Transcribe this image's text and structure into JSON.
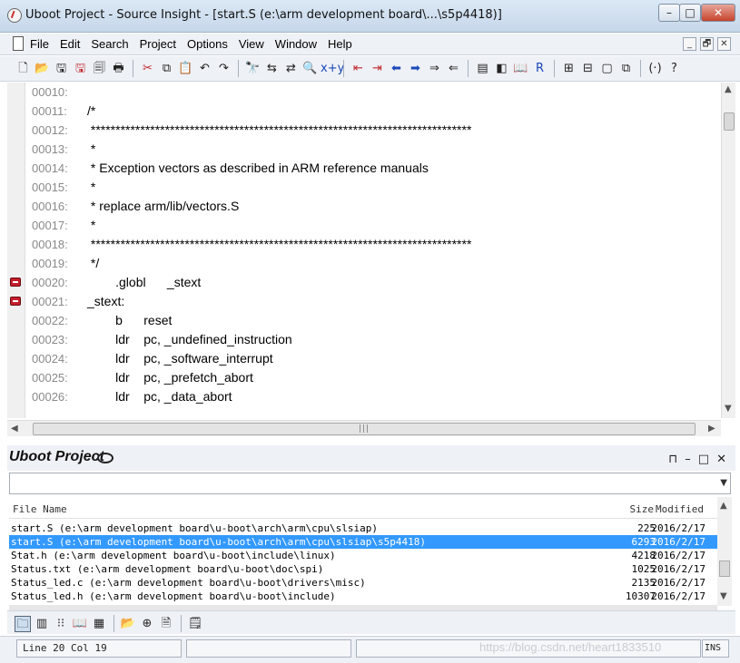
{
  "window": {
    "title": "Uboot Project - Source Insight - [start.S (e:\\arm development board\\...\\s5p4418)]",
    "controls": {
      "minimize": "–",
      "maximize": "□",
      "close": "✕"
    }
  },
  "menu": {
    "items": [
      "File",
      "Edit",
      "Search",
      "Project",
      "Options",
      "View",
      "Window",
      "Help"
    ],
    "mdi_controls": [
      "_",
      "🗗",
      "✕"
    ]
  },
  "toolbar": {
    "groups": [
      [
        {
          "name": "new-icon",
          "glyph": "🗋",
          "tone": "dark"
        },
        {
          "name": "open-icon",
          "glyph": "📂",
          "tone": "dark"
        },
        {
          "name": "save-icon",
          "glyph": "🖫",
          "tone": "dark"
        },
        {
          "name": "save-all-icon",
          "glyph": "🖫",
          "tone": "red"
        },
        {
          "name": "close-file-icon",
          "glyph": "🗐",
          "tone": "dark"
        },
        {
          "name": "print-icon",
          "glyph": "🖶",
          "tone": "dark"
        }
      ],
      [
        {
          "name": "cut-icon",
          "glyph": "✂",
          "tone": "red"
        },
        {
          "name": "copy-icon",
          "glyph": "⧉",
          "tone": "dark"
        },
        {
          "name": "paste-icon",
          "glyph": "📋",
          "tone": "dark"
        },
        {
          "name": "undo-icon",
          "glyph": "↶",
          "tone": "dark"
        },
        {
          "name": "redo-icon",
          "glyph": "↷",
          "tone": "dark"
        }
      ],
      [
        {
          "name": "find-icon",
          "glyph": "🔭",
          "tone": "dark"
        },
        {
          "name": "find-prev-icon",
          "glyph": "⇆",
          "tone": "dark"
        },
        {
          "name": "find-next-icon",
          "glyph": "⇄",
          "tone": "dark"
        },
        {
          "name": "search-files-icon",
          "glyph": "🔍",
          "tone": "dark"
        },
        {
          "name": "replace-icon",
          "glyph": "x+y",
          "tone": "blue"
        }
      ],
      [
        {
          "name": "bookmark-prev-icon",
          "glyph": "⇤",
          "tone": "red"
        },
        {
          "name": "bookmark-next-icon",
          "glyph": "⇥",
          "tone": "red"
        },
        {
          "name": "back-icon",
          "glyph": "⬅",
          "tone": "blue"
        },
        {
          "name": "forward-icon",
          "glyph": "➡",
          "tone": "blue"
        },
        {
          "name": "jump-in-icon",
          "glyph": "⇒",
          "tone": "dark"
        },
        {
          "name": "jump-out-icon",
          "glyph": "⇐",
          "tone": "dark"
        }
      ],
      [
        {
          "name": "symbol-window-icon",
          "glyph": "▤",
          "tone": "dark"
        },
        {
          "name": "lookup-icon",
          "glyph": "◧",
          "tone": "dark"
        },
        {
          "name": "browse-icon",
          "glyph": "📖",
          "tone": "dark"
        },
        {
          "name": "relation-icon",
          "glyph": "R",
          "tone": "blue"
        }
      ],
      [
        {
          "name": "tile-icon",
          "glyph": "⊞",
          "tone": "dark"
        },
        {
          "name": "split-icon",
          "glyph": "⊟",
          "tone": "dark"
        },
        {
          "name": "window-icon",
          "glyph": "▢",
          "tone": "dark"
        },
        {
          "name": "cascade-icon",
          "glyph": "⧉",
          "tone": "dark"
        }
      ],
      [
        {
          "name": "param-icon",
          "glyph": "(·)",
          "tone": "dark"
        },
        {
          "name": "help-icon",
          "glyph": "?",
          "tone": "dark"
        }
      ]
    ]
  },
  "editor": {
    "lines": [
      {
        "num": "00010:",
        "text": ""
      },
      {
        "num": "00011:",
        "text": "/*"
      },
      {
        "num": "00012:",
        "text": " *****************************************************************************"
      },
      {
        "num": "00013:",
        "text": " *"
      },
      {
        "num": "00014:",
        "text": " * Exception vectors as described in ARM reference manuals"
      },
      {
        "num": "00015:",
        "text": " *"
      },
      {
        "num": "00016:",
        "text": " * replace arm/lib/vectors.S"
      },
      {
        "num": "00017:",
        "text": " *"
      },
      {
        "num": "00018:",
        "text": " *****************************************************************************"
      },
      {
        "num": "00019:",
        "text": " */"
      },
      {
        "num": "00020:",
        "text": "        .globl      _stext"
      },
      {
        "num": "00021:",
        "text": "_stext:"
      },
      {
        "num": "00022:",
        "text": "        b      reset"
      },
      {
        "num": "00023:",
        "text": "        ldr    pc, _undefined_instruction"
      },
      {
        "num": "00024:",
        "text": "        ldr    pc, _software_interrupt"
      },
      {
        "num": "00025:",
        "text": "        ldr    pc, _prefetch_abort"
      },
      {
        "num": "00026:",
        "text": "        ldr    pc, _data_abort"
      }
    ],
    "bookmarked_lines": [
      "00020:",
      "00021:"
    ],
    "hscroll_grip": "|||"
  },
  "project_panel": {
    "title": "Uboot Project",
    "controls": [
      "⊓",
      "–",
      "□",
      "✕"
    ],
    "filter_value": "",
    "columns": {
      "name": "File Name",
      "size": "Size",
      "modified": "Modified"
    },
    "files": [
      {
        "name": "start.S (e:\\arm development board\\u-boot\\arch\\arm\\cpu\\slsiap)",
        "size": "225",
        "modified": "2016/2/17",
        "selected": false
      },
      {
        "name": "start.S (e:\\arm development board\\u-boot\\arch\\arm\\cpu\\slsiap\\s5p4418)",
        "size": "6293",
        "modified": "2016/2/17",
        "selected": true
      },
      {
        "name": "Stat.h (e:\\arm development board\\u-boot\\include\\linux)",
        "size": "4218",
        "modified": "2016/2/17",
        "selected": false
      },
      {
        "name": "Status.txt (e:\\arm development board\\u-boot\\doc\\spi)",
        "size": "1025",
        "modified": "2016/2/17",
        "selected": false
      },
      {
        "name": "Status_led.c (e:\\arm development board\\u-boot\\drivers\\misc)",
        "size": "2135",
        "modified": "2016/2/17",
        "selected": false
      },
      {
        "name": "Status_led.h (e:\\arm development board\\u-boot\\include)",
        "size": "10307",
        "modified": "2016/2/17",
        "selected": false
      }
    ],
    "toolbar": [
      {
        "name": "file-list-icon",
        "glyph": "🗀",
        "active": true
      },
      {
        "name": "symbol-list-icon",
        "glyph": "▥",
        "active": false
      },
      {
        "name": "tree-icon",
        "glyph": "⁝⁝",
        "active": false
      },
      {
        "name": "book-icon",
        "glyph": "📖",
        "active": false
      },
      {
        "name": "color-icon",
        "glyph": "▦",
        "active": false
      },
      {
        "name": "folder-open-icon",
        "glyph": "📂",
        "active": false
      },
      {
        "name": "add-file-icon",
        "glyph": "⊕",
        "active": false
      },
      {
        "name": "doc-icon",
        "glyph": "🗎",
        "active": false
      },
      {
        "name": "properties-icon",
        "glyph": "🗒",
        "active": false
      }
    ]
  },
  "status": {
    "position": "Line 20  Col 19",
    "middle": "",
    "main": "",
    "mode": "INS",
    "watermark": "https://blog.csdn.net/heart1833510"
  }
}
